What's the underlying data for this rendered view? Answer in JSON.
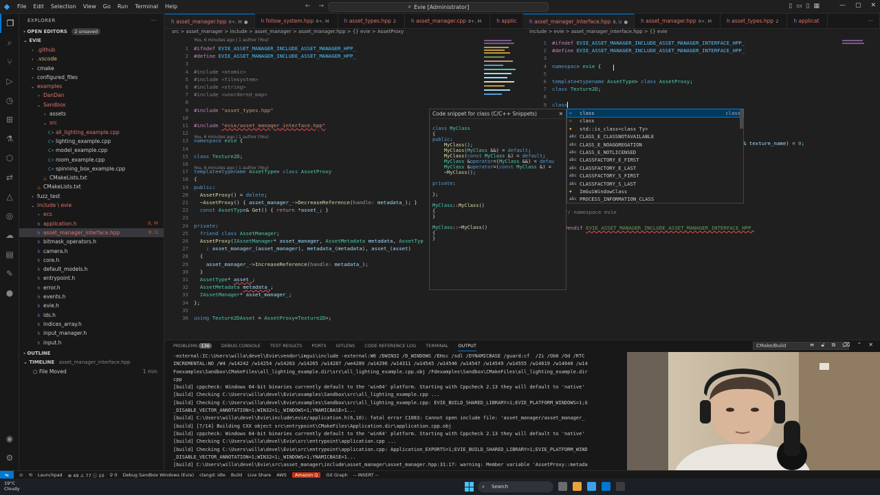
{
  "titlebar": {
    "menu": [
      "File",
      "Edit",
      "Selection",
      "View",
      "Go",
      "Run",
      "Terminal",
      "Help"
    ],
    "search": "Evie [Administrator]"
  },
  "sidebar": {
    "title": "EXPLORER",
    "open_editors": "OPEN EDITORS",
    "unsaved": "2 unsaved",
    "root": "EVIE",
    "items": [
      {
        "label": ".github",
        "depth": 1,
        "kind": "folder",
        "color": "red"
      },
      {
        "label": ".vscode",
        "depth": 1,
        "kind": "folder",
        "color": "orange"
      },
      {
        "label": "cmake",
        "depth": 1,
        "kind": "folder",
        "color": "plain"
      },
      {
        "label": "configured_files",
        "depth": 1,
        "kind": "folder",
        "color": "plain"
      },
      {
        "label": "examples",
        "depth": 1,
        "kind": "folder-open",
        "color": "red"
      },
      {
        "label": "DanDan",
        "depth": 2,
        "kind": "folder",
        "color": "red"
      },
      {
        "label": "Sandbox",
        "depth": 2,
        "kind": "folder-open",
        "color": "red"
      },
      {
        "label": "assets",
        "depth": 3,
        "kind": "folder",
        "color": "plain"
      },
      {
        "label": "src",
        "depth": 3,
        "kind": "folder-open",
        "color": "red"
      },
      {
        "label": "all_lighting_example.cpp",
        "depth": 4,
        "kind": "cpp",
        "color": "red"
      },
      {
        "label": "lighting_example.cpp",
        "depth": 4,
        "kind": "cpp",
        "color": "plain"
      },
      {
        "label": "model_example.cpp",
        "depth": 4,
        "kind": "cpp",
        "color": "plain"
      },
      {
        "label": "room_example.cpp",
        "depth": 4,
        "kind": "cpp",
        "color": "plain"
      },
      {
        "label": "spinning_box_example.cpp",
        "depth": 4,
        "kind": "cpp",
        "color": "plain"
      },
      {
        "label": "CMakeLists.txt",
        "depth": 3,
        "kind": "cmake",
        "color": "plain"
      },
      {
        "label": "CMakeLists.txt",
        "depth": 2,
        "kind": "cmake",
        "color": "plain"
      },
      {
        "label": "fuzz_test",
        "depth": 1,
        "kind": "folder",
        "color": "plain"
      },
      {
        "label": "include \\ evie",
        "depth": 1,
        "kind": "folder-open",
        "color": "red"
      },
      {
        "label": "ecs",
        "depth": 2,
        "kind": "folder",
        "color": "red"
      },
      {
        "label": "application.h",
        "depth": 2,
        "kind": "h",
        "color": "red",
        "badge": "8, M"
      },
      {
        "label": "asset_manager_interface.hpp",
        "depth": 2,
        "kind": "hpp",
        "color": "red",
        "badge": "8, U",
        "selected": true
      },
      {
        "label": "bitmask_operators.h",
        "depth": 2,
        "kind": "h",
        "color": "plain"
      },
      {
        "label": "camera.h",
        "depth": 2,
        "kind": "h",
        "color": "plain"
      },
      {
        "label": "core.h",
        "depth": 2,
        "kind": "h",
        "color": "plain"
      },
      {
        "label": "default_models.h",
        "depth": 2,
        "kind": "h",
        "color": "plain"
      },
      {
        "label": "entrypoint.h",
        "depth": 2,
        "kind": "h",
        "color": "plain"
      },
      {
        "label": "error.h",
        "depth": 2,
        "kind": "h",
        "color": "plain"
      },
      {
        "label": "events.h",
        "depth": 2,
        "kind": "h",
        "color": "plain"
      },
      {
        "label": "evie.h",
        "depth": 2,
        "kind": "h",
        "color": "plain"
      },
      {
        "label": "ids.h",
        "depth": 2,
        "kind": "h",
        "color": "plain"
      },
      {
        "label": "indices_array.h",
        "depth": 2,
        "kind": "h",
        "color": "plain"
      },
      {
        "label": "input_manager.h",
        "depth": 2,
        "kind": "h",
        "color": "plain"
      },
      {
        "label": "input.h",
        "depth": 2,
        "kind": "h",
        "color": "plain"
      }
    ],
    "outline": "OUTLINE",
    "timeline": "TIMELINE",
    "timeline_file": "asset_manager_interface.hpp",
    "timeline_entry": "File Moved",
    "timeline_when": "1 min"
  },
  "left_editor": {
    "tabs": [
      {
        "name": "asset_manager.hpp",
        "suffix": "9+, M",
        "color": "red",
        "active": true
      },
      {
        "name": "follow_system.hpp",
        "suffix": "9+, M",
        "color": "red"
      },
      {
        "name": "asset_types.hpp",
        "suffix": "2",
        "color": "red"
      },
      {
        "name": "asset_manager.cpp",
        "suffix": "9+, M",
        "color": "red"
      },
      {
        "name": "applic",
        "suffix": "",
        "color": "red"
      }
    ],
    "breadcrumb": "src > asset_manager > include > asset_manager > asset_manager.hpp > {} evie > AssetProxy"
  },
  "right_editor": {
    "tabs": [
      {
        "name": "asset_manager_interface.hpp",
        "suffix": "8, U",
        "color": "red",
        "active": true
      },
      {
        "name": "asset_manager.hpp",
        "suffix": "9+, M",
        "color": "red"
      },
      {
        "name": "asset_types.hpp",
        "suffix": "2",
        "color": "red"
      },
      {
        "name": "applicat",
        "suffix": "",
        "color": "red"
      }
    ],
    "breadcrumb": "include > evie > asset_manager_interface.hpp > {} evie"
  },
  "snippet": {
    "title": "Code snippet for class (C/C++ Snippets)",
    "close": "✕"
  },
  "suggest": {
    "items": [
      {
        "icon": "snippet",
        "label": "class",
        "detail": "class",
        "selected": true
      },
      {
        "icon": "keyword",
        "label": "class",
        "detail": ""
      },
      {
        "icon": "struct",
        "label": "std::is_class<class Ty>",
        "detail": ""
      },
      {
        "icon": "abc",
        "label": "CLASS_E_CLASSNOTAVAILABLE",
        "detail": ""
      },
      {
        "icon": "abc",
        "label": "CLASS_E_NOAGGREGATION",
        "detail": ""
      },
      {
        "icon": "abc",
        "label": "CLASS_E_NOTLICENSED",
        "detail": ""
      },
      {
        "icon": "abc",
        "label": "CLASSFACTORY_E_FIRST",
        "detail": ""
      },
      {
        "icon": "abc",
        "label": "CLASSFACTORY_E_LAST",
        "detail": ""
      },
      {
        "icon": "abc",
        "label": "CLASSFACTORY_S_FIRST",
        "detail": ""
      },
      {
        "icon": "abc",
        "label": "CLASSFACTORY_S_LAST",
        "detail": ""
      },
      {
        "icon": "struct",
        "label": "ImGuiWindowClass",
        "detail": ""
      },
      {
        "icon": "abc",
        "label": "PROCESS_INFORMATION_CLASS",
        "detail": ""
      }
    ]
  },
  "panel": {
    "tabs": [
      "PROBLEMS",
      "DEBUG CONSOLE",
      "TEST RESULTS",
      "PORTS",
      "GITLENS",
      "CODE REFERENCE LOG",
      "TERMINAL",
      "OUTPUT"
    ],
    "problems_count": "136",
    "output_channel": "CMake/Build",
    "lines": [
      "-external:IC:\\Users\\willa\\devel\\Evie\\vendor\\imgui\\include -external:W0 /DWIN32 /D_WINDOWS /EHsc /sdl /DYNAMICBASE /guard:cf  /Zi /Ob0 /Od /RTC",
      "INCREMENTAL:NO /W4 /w14242 /w14254 /w14263 /w14265 /w14287 /we4289 /w14296 /w14311 /w14545 /w14546 /w14547 /w14549 /w14555 /w14619 /w14640 /w14",
      "Foexamples\\Sandbox\\CMakeFiles\\all_lighting_example.dir\\src\\all_lighting_example.cpp.obj /Fdexamples\\Sandbox\\CMakeFiles\\all_lighting_example.dir",
      "cpp",
      "[build] cppcheck: Windows 64-bit binaries currently default to the 'win64' platform. Starting with Cppcheck 2.13 they will default to 'native'",
      "[build] Checking C:\\Users\\willa\\devel\\Evie\\examples\\Sandbox\\src\\all_lighting_example.cpp ...",
      "[build] Checking C:\\Users\\willa\\devel\\Evie\\examples\\Sandbox\\src\\all_lighting_example.cpp: EVIE_BUILD_SHARED_LIBRARY=1;EVIE_PLATFORM_WINDOWS=1;G",
      "_DISABLE_VECTOR_ANNOTATION=1;WIN32=1;_WINDOWS=1;YNAMICBASE=1...",
      "[build] C:\\Users\\willa\\devel\\Evie\\include\\evie/application.h(6,10): fatal error C1083: Cannot open include file: 'asset_manager/asset_manager_",
      "[build] [7/14] Building CXX object src\\entrypoint\\CMakeFiles\\Application.dir\\application.cpp.obj",
      "[build] cppcheck: Windows 64-bit binaries currently default to the 'win64' platform. Starting with Cppcheck 2.13 they will default to 'native'",
      "[build] Checking C:\\Users\\willa\\devel\\Evie\\src\\entrypoint\\application.cpp ...",
      "[build] Checking C:\\Users\\willa\\devel\\Evie\\src\\entrypoint\\application.cpp: Application_EXPORTS=1;EVIE_BUILD_SHARED_LIBRARY=1;EVIE_PLATFORM_WIND",
      "_DISABLE_VECTOR_ANNOTATION=1;WIN32=1;_WINDOWS=1;YNAMICBASE=1...",
      "[build] C:\\Users\\willa\\devel\\Evie\\src\\asset_manager\\include\\asset_manager\\asset_manager.hpp:31:17: warning: Member variable 'AssetProxy::metada"
    ]
  },
  "statusbar": {
    "branch": "Launchpad",
    "errors": "⊗ 49  ⚠ 77  ⓘ 10",
    "ports": "⚲ 0",
    "debug": "Debug Sandbox Windows (Evie)",
    "clangd": "clangd: idle",
    "build": "Build",
    "live": "Live Share",
    "aws": "AWS",
    "amazonq": "Amazon Q",
    "graph": "Git Graph",
    "mode": "-- INSERT --"
  },
  "taskbar": {
    "temp": "19°C",
    "weather": "Cloudy",
    "search": "Search"
  }
}
